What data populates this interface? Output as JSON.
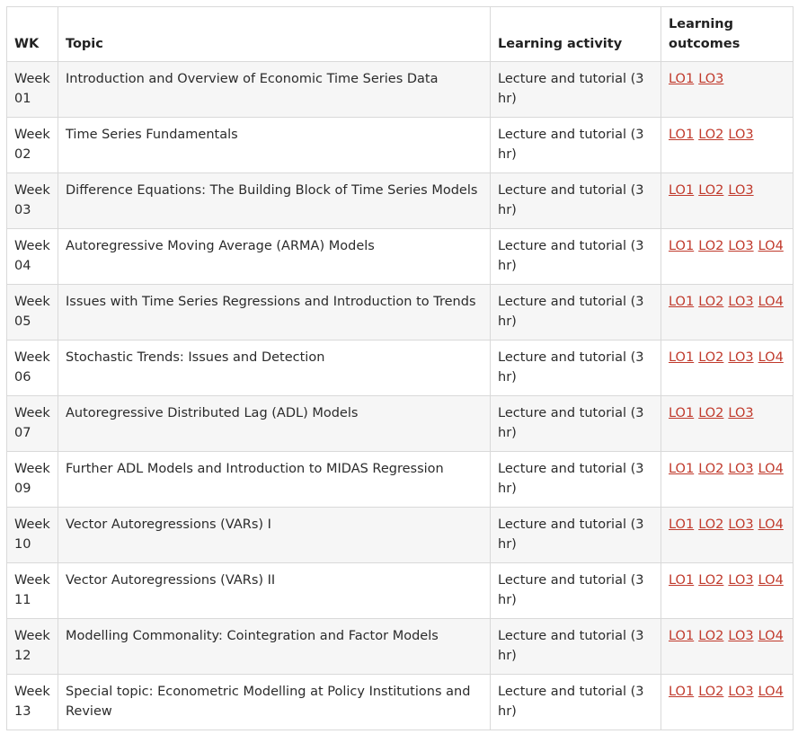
{
  "headers": {
    "wk": "WK",
    "topic": "Topic",
    "activity": "Learning activity",
    "outcomes": "Learning outcomes"
  },
  "rows": [
    {
      "wk": "Week 01",
      "topic": "Introduction and Overview of Economic Time Series Data",
      "activity": "Lecture and tutorial (3 hr)",
      "los": [
        "LO1",
        "LO3"
      ]
    },
    {
      "wk": "Week 02",
      "topic": "Time Series Fundamentals",
      "activity": "Lecture and tutorial (3 hr)",
      "los": [
        "LO1",
        "LO2",
        "LO3"
      ]
    },
    {
      "wk": "Week 03",
      "topic": "Difference Equations: The Building Block of Time Series Models",
      "activity": "Lecture and tutorial (3 hr)",
      "los": [
        "LO1",
        "LO2",
        "LO3"
      ]
    },
    {
      "wk": "Week 04",
      "topic": "Autoregressive Moving Average (ARMA) Models",
      "activity": "Lecture and tutorial (3 hr)",
      "los": [
        "LO1",
        "LO2",
        "LO3",
        "LO4"
      ]
    },
    {
      "wk": "Week 05",
      "topic": "Issues with Time Series Regressions and Introduction to Trends",
      "activity": "Lecture and tutorial (3 hr)",
      "los": [
        "LO1",
        "LO2",
        "LO3",
        "LO4"
      ]
    },
    {
      "wk": "Week 06",
      "topic": "Stochastic Trends: Issues and Detection",
      "activity": "Lecture and tutorial (3 hr)",
      "los": [
        "LO1",
        "LO2",
        "LO3",
        "LO4"
      ]
    },
    {
      "wk": "Week 07",
      "topic": "Autoregressive Distributed Lag (ADL) Models",
      "activity": "Lecture and tutorial (3 hr)",
      "los": [
        "LO1",
        "LO2",
        "LO3"
      ]
    },
    {
      "wk": "Week 09",
      "topic": "Further ADL Models and Introduction to MIDAS Regression",
      "activity": "Lecture and tutorial (3 hr)",
      "los": [
        "LO1",
        "LO2",
        "LO3",
        "LO4"
      ]
    },
    {
      "wk": "Week 10",
      "topic": "Vector Autoregressions (VARs) I",
      "activity": "Lecture and tutorial (3 hr)",
      "los": [
        "LO1",
        "LO2",
        "LO3",
        "LO4"
      ]
    },
    {
      "wk": "Week 11",
      "topic": "Vector Autoregressions (VARs) II",
      "activity": "Lecture and tutorial (3 hr)",
      "los": [
        "LO1",
        "LO2",
        "LO3",
        "LO4"
      ]
    },
    {
      "wk": "Week 12",
      "topic": "Modelling Commonality: Cointegration and Factor Models",
      "activity": "Lecture and tutorial (3 hr)",
      "los": [
        "LO1",
        "LO2",
        "LO3",
        "LO4"
      ]
    },
    {
      "wk": "Week 13",
      "topic": "Special topic: Econometric Modelling at Policy Institutions and Review",
      "activity": "Lecture and tutorial (3 hr)",
      "los": [
        "LO1",
        "LO2",
        "LO3",
        "LO4"
      ]
    }
  ],
  "colors": {
    "link": "#c0392b",
    "row_alt": "#f6f6f6",
    "border": "#d9d9d9"
  }
}
